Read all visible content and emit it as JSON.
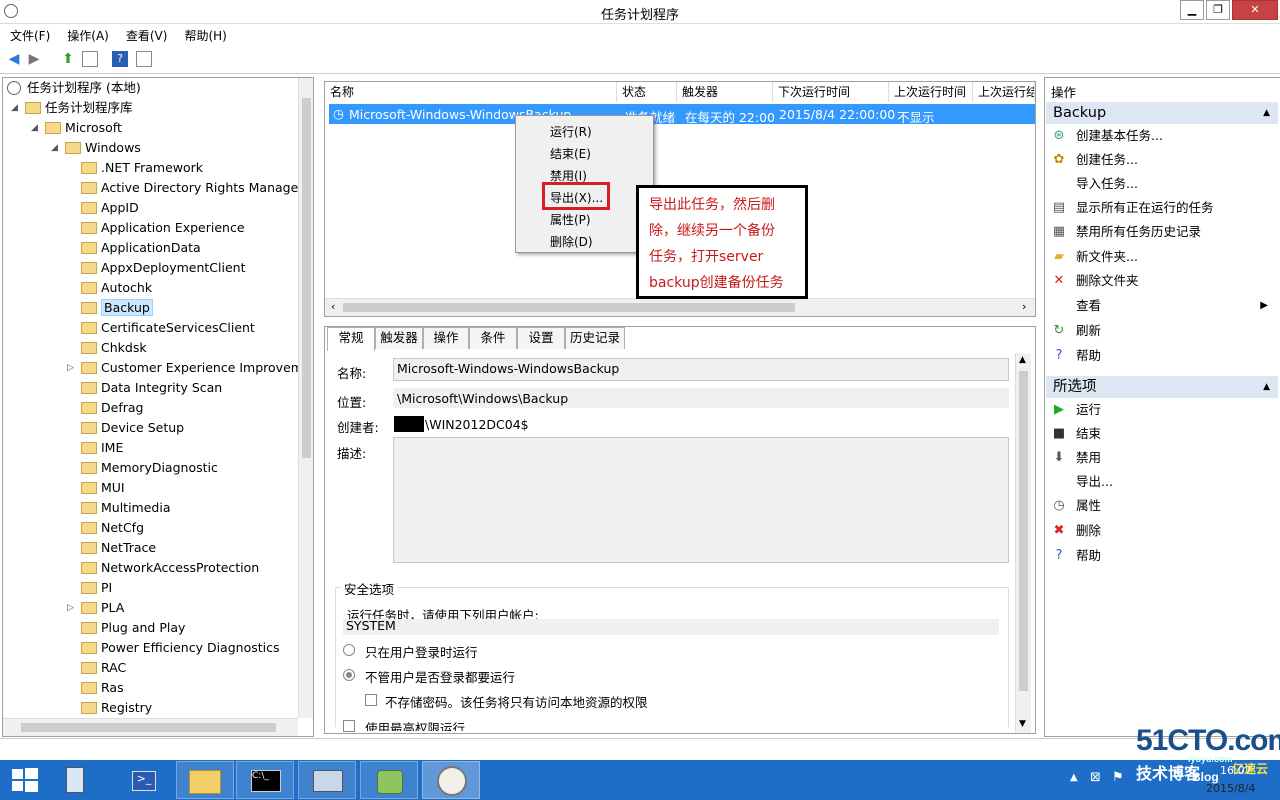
{
  "window": {
    "title": "任务计划程序",
    "min_label": "▁",
    "max_label": "❐",
    "close_label": "✕"
  },
  "menu": [
    "文件(F)",
    "操作(A)",
    "查看(V)",
    "帮助(H)"
  ],
  "tree": {
    "root": "任务计划程序 (本地)",
    "library": "任务计划程序库",
    "microsoft": "Microsoft",
    "windows": "Windows",
    "folders": [
      ".NET Framework",
      "Active Directory Rights Managem",
      "AppID",
      "Application Experience",
      "ApplicationData",
      "AppxDeploymentClient",
      "Autochk",
      "Backup",
      "CertificateServicesClient",
      "Chkdsk",
      "Customer Experience Improveme",
      "Data Integrity Scan",
      "Defrag",
      "Device Setup",
      "IME",
      "MemoryDiagnostic",
      "MUI",
      "Multimedia",
      "NetCfg",
      "NetTrace",
      "NetworkAccessProtection",
      "PI",
      "PLA",
      "Plug and Play",
      "Power Efficiency Diagnostics",
      "RAC",
      "Ras",
      "Registry"
    ],
    "selected": "Backup"
  },
  "task_list": {
    "columns": [
      "名称",
      "状态",
      "触发器",
      "下次运行时间",
      "上次运行时间",
      "上次运行结"
    ],
    "row": {
      "name": "Microsoft-Windows-WindowsBackup",
      "status": "准备就绪",
      "trigger": "在每天的 22:00",
      "next": "2015/8/4 22:00:00",
      "last": "不显示"
    }
  },
  "context_menu": [
    "运行(R)",
    "结束(E)",
    "禁用(I)",
    "导出(X)...",
    "属性(P)",
    "删除(D)"
  ],
  "annotation": [
    "导出此任务，然后删",
    "除，继续另一个备份",
    "任务，打开server",
    "backup创建备份任务"
  ],
  "details": {
    "tabs": [
      "常规",
      "触发器",
      "操作",
      "条件",
      "设置",
      "历史记录"
    ],
    "name_label": "名称:",
    "name_value": "Microsoft-Windows-WindowsBackup",
    "location_label": "位置:",
    "location_value": "\\Microsoft\\Windows\\Backup",
    "author_label": "创建者:",
    "author_value": "\\WIN2012DC04$",
    "desc_label": "描述:",
    "security_title": "安全选项",
    "run_as_label": "运行任务时，请使用下列用户帐户:",
    "run_as_value": "SYSTEM",
    "opt_logged_on": "只在用户登录时运行",
    "opt_whether": "不管用户是否登录都要运行",
    "opt_no_store": "不存储密码。该任务将只有访问本地资源的权限",
    "opt_highest": "使用最高权限运行"
  },
  "actions": {
    "header": "操作",
    "sec1": "Backup",
    "sec1_items": [
      "创建基本任务...",
      "创建任务...",
      "导入任务...",
      "显示所有正在运行的任务",
      "禁用所有任务历史记录",
      "新文件夹...",
      "删除文件夹",
      "查看",
      "刷新",
      "帮助"
    ],
    "sec2": "所选项",
    "sec2_items": [
      "运行",
      "结束",
      "禁用",
      "导出...",
      "属性",
      "删除",
      "帮助"
    ]
  },
  "watermark": {
    "site": "51CTO.com",
    "sub": "技术博客",
    "blog": "Blog",
    "yun": "亿速云",
    "yun_url": "iyuyu.com"
  },
  "clock": {
    "time": "16:07",
    "date": "2015/8/4"
  },
  "colors": {
    "selection": "#3399ff",
    "taskbar": "#1e6ec8",
    "annotation_text": "#c81919",
    "highlight_box": "#d32020"
  }
}
